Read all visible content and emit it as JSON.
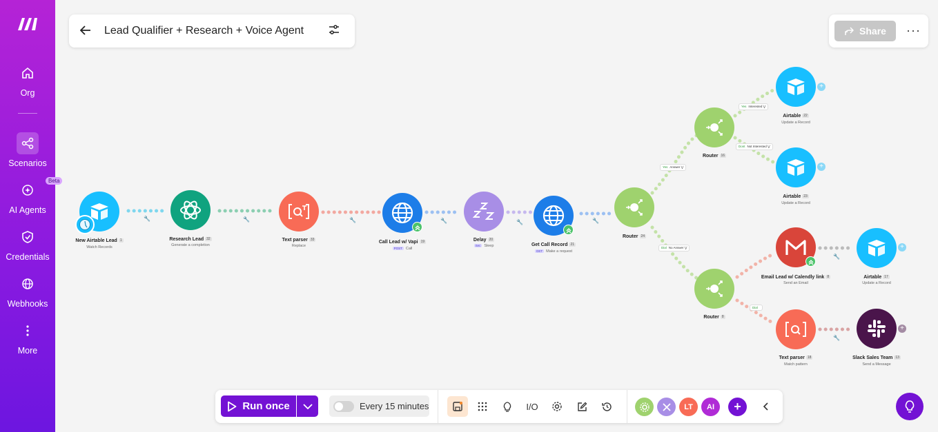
{
  "sidebar": {
    "items": [
      {
        "label": "Org",
        "icon": "home-icon"
      },
      {
        "label": "Scenarios",
        "icon": "scenarios-icon"
      },
      {
        "label": "AI Agents",
        "icon": "ai-agents-icon",
        "badge": "Beta"
      },
      {
        "label": "Credentials",
        "icon": "shield-icon"
      },
      {
        "label": "Webhooks",
        "icon": "globe-icon"
      },
      {
        "label": "More",
        "icon": "more-vertical-icon"
      }
    ],
    "active": "Scenarios"
  },
  "header": {
    "title": "Lead Qualifier + Research + Voice Agent",
    "share_label": "Share"
  },
  "modules": [
    {
      "label": "New Airtable Lead",
      "num": "1",
      "sub": "Watch Records",
      "app": "Airtable",
      "color": "#18bfff"
    },
    {
      "label": "Research Lead",
      "num": "32",
      "sub": "Generate a completion",
      "app": "OpenAI",
      "color": "#10a37f"
    },
    {
      "label": "Text parser",
      "num": "33",
      "sub": "Replace",
      "app": "Text parser",
      "color": "#f86b56"
    },
    {
      "label": "Call Lead w/ Vapi",
      "num": "19",
      "sub": "Call",
      "tag": "POST",
      "app": "HTTP",
      "color": "#1d7de8"
    },
    {
      "label": "Delay",
      "num": "20",
      "sub": "Sleep",
      "tag": "Sec",
      "app": "Sleep",
      "color": "#a88ee6"
    },
    {
      "label": "Get Call Record",
      "num": "21",
      "sub": "Make a request",
      "tag": "GET",
      "app": "HTTP",
      "color": "#1d7de8"
    },
    {
      "label": "Router",
      "num": "24",
      "sub": "",
      "app": "Router",
      "color": "#9fd26e"
    },
    {
      "label": "Router",
      "num": "16",
      "sub": "",
      "app": "Router",
      "color": "#9fd26e"
    },
    {
      "label": "Airtable",
      "num": "22",
      "sub": "Update a Record",
      "app": "Airtable",
      "color": "#18bfff"
    },
    {
      "label": "Airtable",
      "num": "23",
      "sub": "Update a Record",
      "app": "Airtable",
      "color": "#18bfff"
    },
    {
      "label": "Router",
      "num": "8",
      "sub": "",
      "app": "Router",
      "color": "#9fd26e"
    },
    {
      "label": "Email Lead w/ Calendly link",
      "num": "8",
      "sub": "Send an Email",
      "app": "Gmail",
      "color": "#d9453a"
    },
    {
      "label": "Airtable",
      "num": "17",
      "sub": "Update a Record",
      "app": "Airtable",
      "color": "#18bfff"
    },
    {
      "label": "Text parser",
      "num": "18",
      "sub": "Match pattern",
      "app": "Text parser",
      "color": "#f86b56"
    },
    {
      "label": "Slack Sales Team",
      "num": "13",
      "sub": "Send a Message",
      "app": "Slack",
      "color": "#4a154b"
    }
  ],
  "filters": [
    {
      "state": "Yes",
      "label": "Answer"
    },
    {
      "state": "Yes",
      "label": "Interested"
    },
    {
      "state": "Dont",
      "label": "Not Interested"
    },
    {
      "state": "Dial",
      "label": "No Answer"
    },
    {
      "state": "Dial",
      "label": ""
    }
  ],
  "toolbar": {
    "run_label": "Run once",
    "schedule_label": "Every 15 minutes",
    "io_label": "I/O",
    "apps": [
      {
        "label": "",
        "color": "#9fd26e"
      },
      {
        "label": "",
        "color": "#a88ee6"
      },
      {
        "label": "LT",
        "color": "#f86b56"
      },
      {
        "label": "AI",
        "color": "#b02bd6"
      }
    ]
  },
  "colors": {
    "brand": "#7312d4",
    "sidebar_top": "#b523d6",
    "router": "#9fd26e"
  }
}
